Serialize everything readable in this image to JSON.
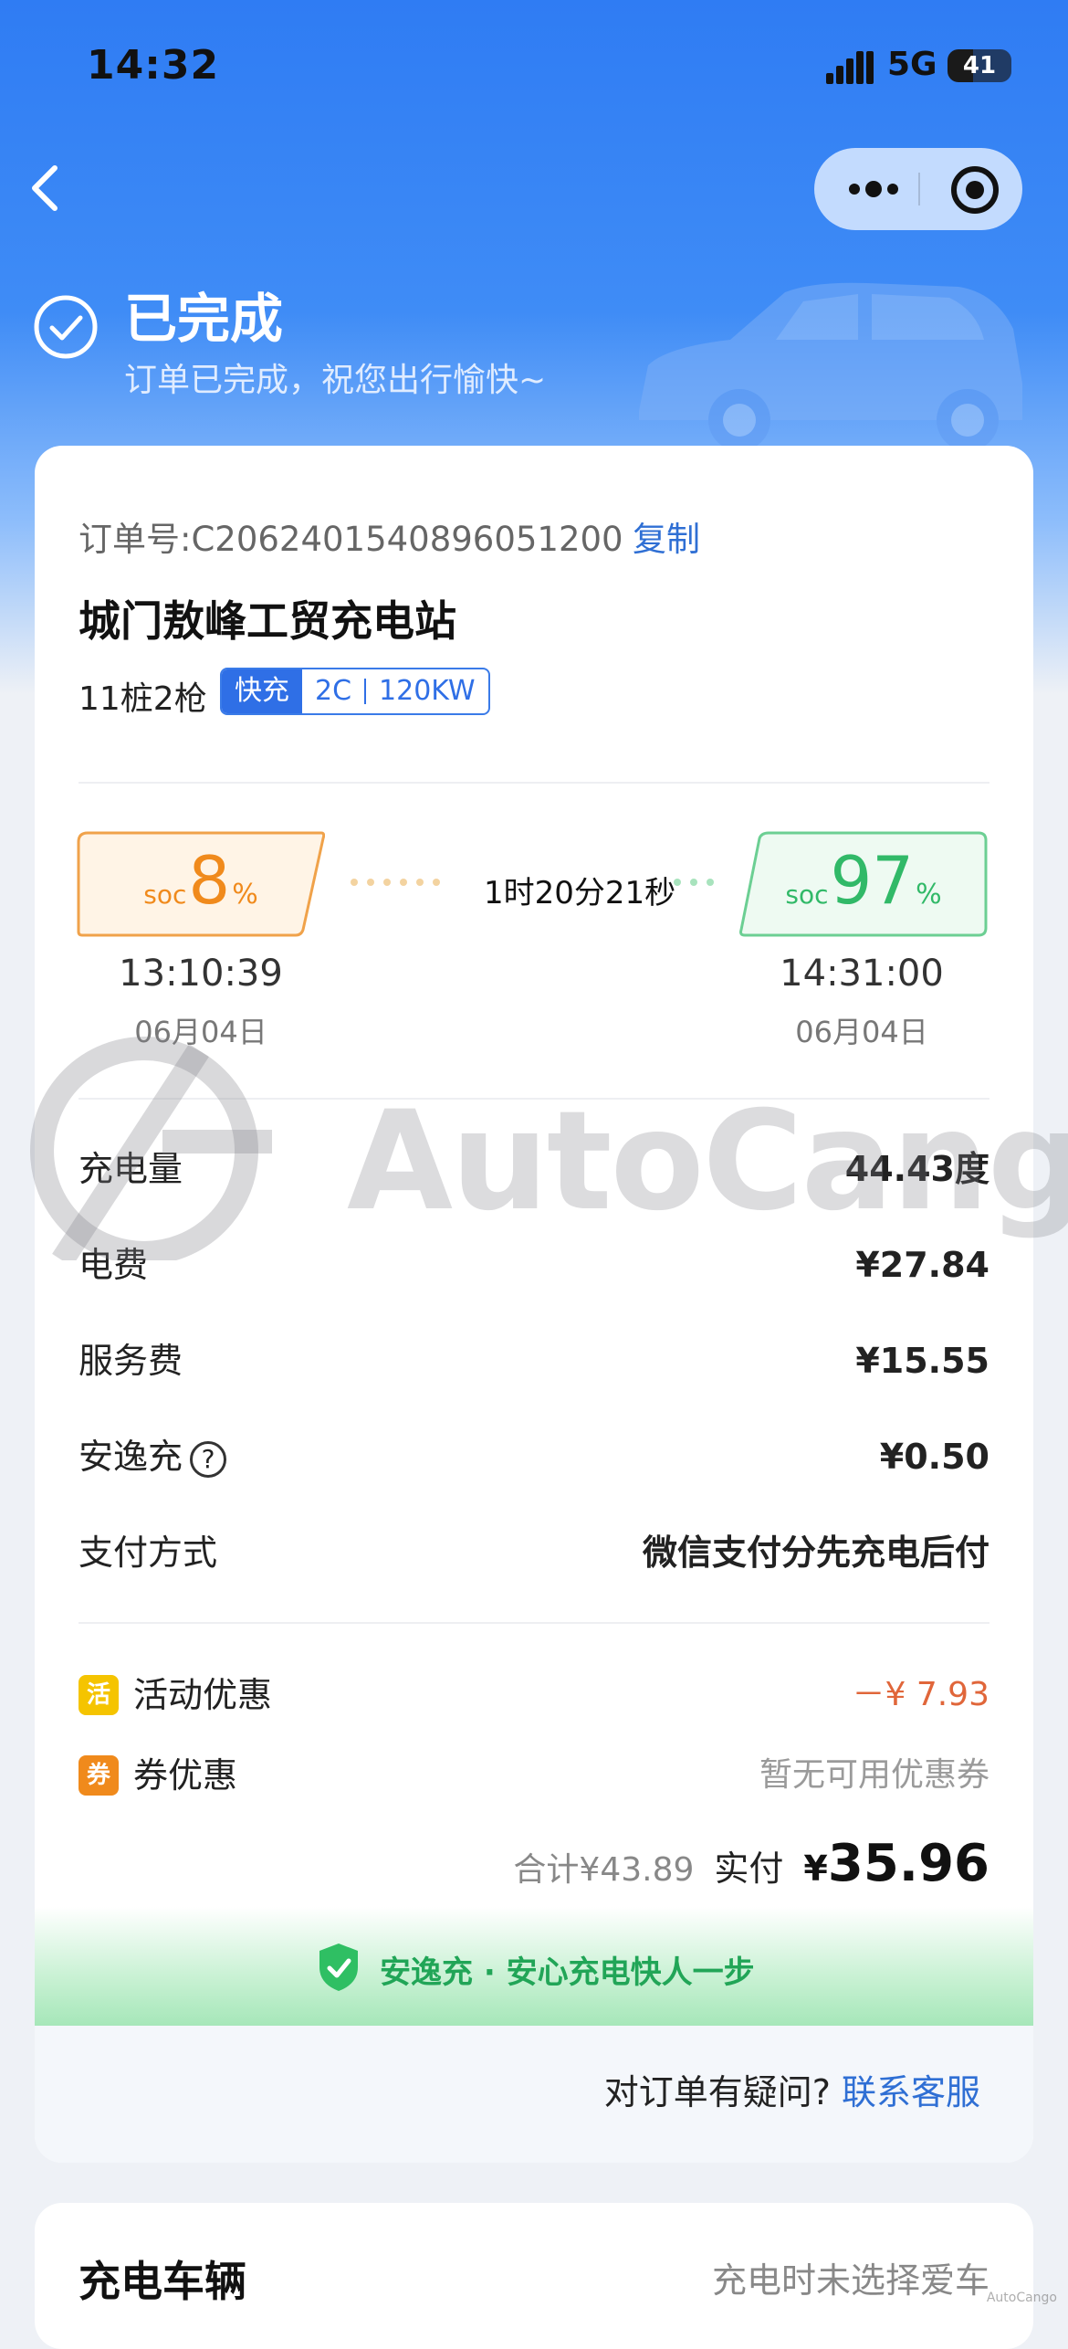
{
  "status_bar": {
    "time": "14:32",
    "network": "5G",
    "battery": "41"
  },
  "header": {
    "status_title": "已完成",
    "status_subtitle": "订单已完成，祝您出行愉快~"
  },
  "order": {
    "order_number": "订单号:C2062401540896051200",
    "copy_label": "复制",
    "station_name": "城门敖峰工贸充电站",
    "piles": "11桩2枪",
    "tags": {
      "fast": "快充",
      "rate": "2C",
      "power": "120KW"
    }
  },
  "charging": {
    "soc_label": "soc",
    "start_soc": "8",
    "end_soc": "97",
    "percent": "%",
    "duration": "1时20分21秒",
    "start_time": "13:10:39",
    "start_date": "06月04日",
    "end_time": "14:31:00",
    "end_date": "06月04日"
  },
  "fees": {
    "energy_label": "充电量",
    "energy_value": "44.43度",
    "electricity_label": "电费",
    "electricity_value": "¥27.84",
    "service_label": "服务费",
    "service_value": "¥15.55",
    "insurance_label": "安逸充",
    "insurance_value": "¥0.50",
    "payment_label": "支付方式",
    "payment_value": "微信支付分先充电后付"
  },
  "promotions": {
    "activity_icon": "活",
    "activity_label": "活动优惠",
    "activity_value": "－¥ 7.93",
    "coupon_icon": "券",
    "coupon_label": "券优惠",
    "coupon_value": "暂无可用优惠券"
  },
  "totals": {
    "total_label": "合计¥43.89",
    "paid_label": "实付",
    "paid_currency": "¥",
    "paid_amount": "35.96"
  },
  "banner": {
    "text": "安逸充 · 安心充电快人一步"
  },
  "help": {
    "question": "对订单有疑问?",
    "link": "联系客服"
  },
  "vehicle": {
    "title": "充电车辆",
    "value": "充电时未选择爱车"
  },
  "watermark": {
    "brand": "AutoCango",
    "corner": "AutoCango"
  },
  "colors": {
    "primary_blue": "#2f7cf3",
    "link_blue": "#2f6fd4",
    "start_orange": "#f08a1c",
    "end_green": "#31b968",
    "discount_red": "#e0663a",
    "activity_yellow": "#f5c400",
    "coupon_orange": "#f08a1c",
    "banner_green": "#21a557"
  },
  "icons": [
    "back-icon",
    "more-icon",
    "target-icon",
    "check-circle-icon",
    "signal-icon",
    "question-icon",
    "shield-icon",
    "car-illustration"
  ]
}
